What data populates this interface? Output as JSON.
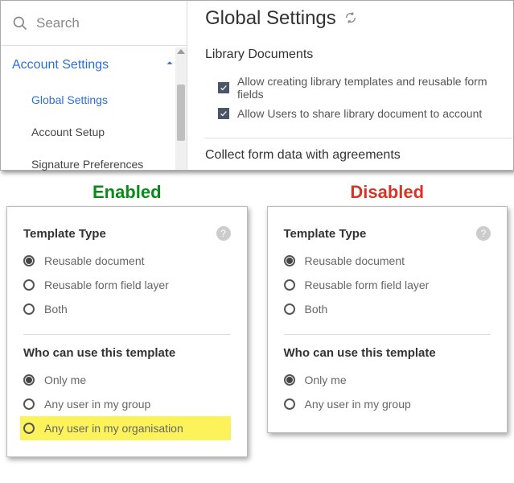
{
  "sidebar": {
    "search_placeholder": "Search",
    "group_label": "Account Settings",
    "items": [
      {
        "label": "Global Settings"
      },
      {
        "label": "Account Setup"
      },
      {
        "label": "Signature Preferences"
      }
    ]
  },
  "page": {
    "title": "Global Settings",
    "section1": "Library Documents",
    "checks": [
      {
        "label": "Allow creating library templates and reusable form fields"
      },
      {
        "label": "Allow Users to share library document to account"
      }
    ],
    "section2": "Collect form data with agreements"
  },
  "card_labels": {
    "enabled": "Enabled",
    "disabled": "Disabled"
  },
  "template_panel": {
    "heading": "Template Type",
    "options": [
      {
        "label": "Reusable document"
      },
      {
        "label": "Reusable form field layer"
      },
      {
        "label": "Both"
      }
    ],
    "who_heading": "Who can use this template",
    "who_options_enabled": [
      {
        "label": "Only me"
      },
      {
        "label": "Any user in my group"
      },
      {
        "label": "Any user in my organisation"
      }
    ],
    "who_options_disabled": [
      {
        "label": "Only me"
      },
      {
        "label": "Any user in my group"
      }
    ]
  }
}
